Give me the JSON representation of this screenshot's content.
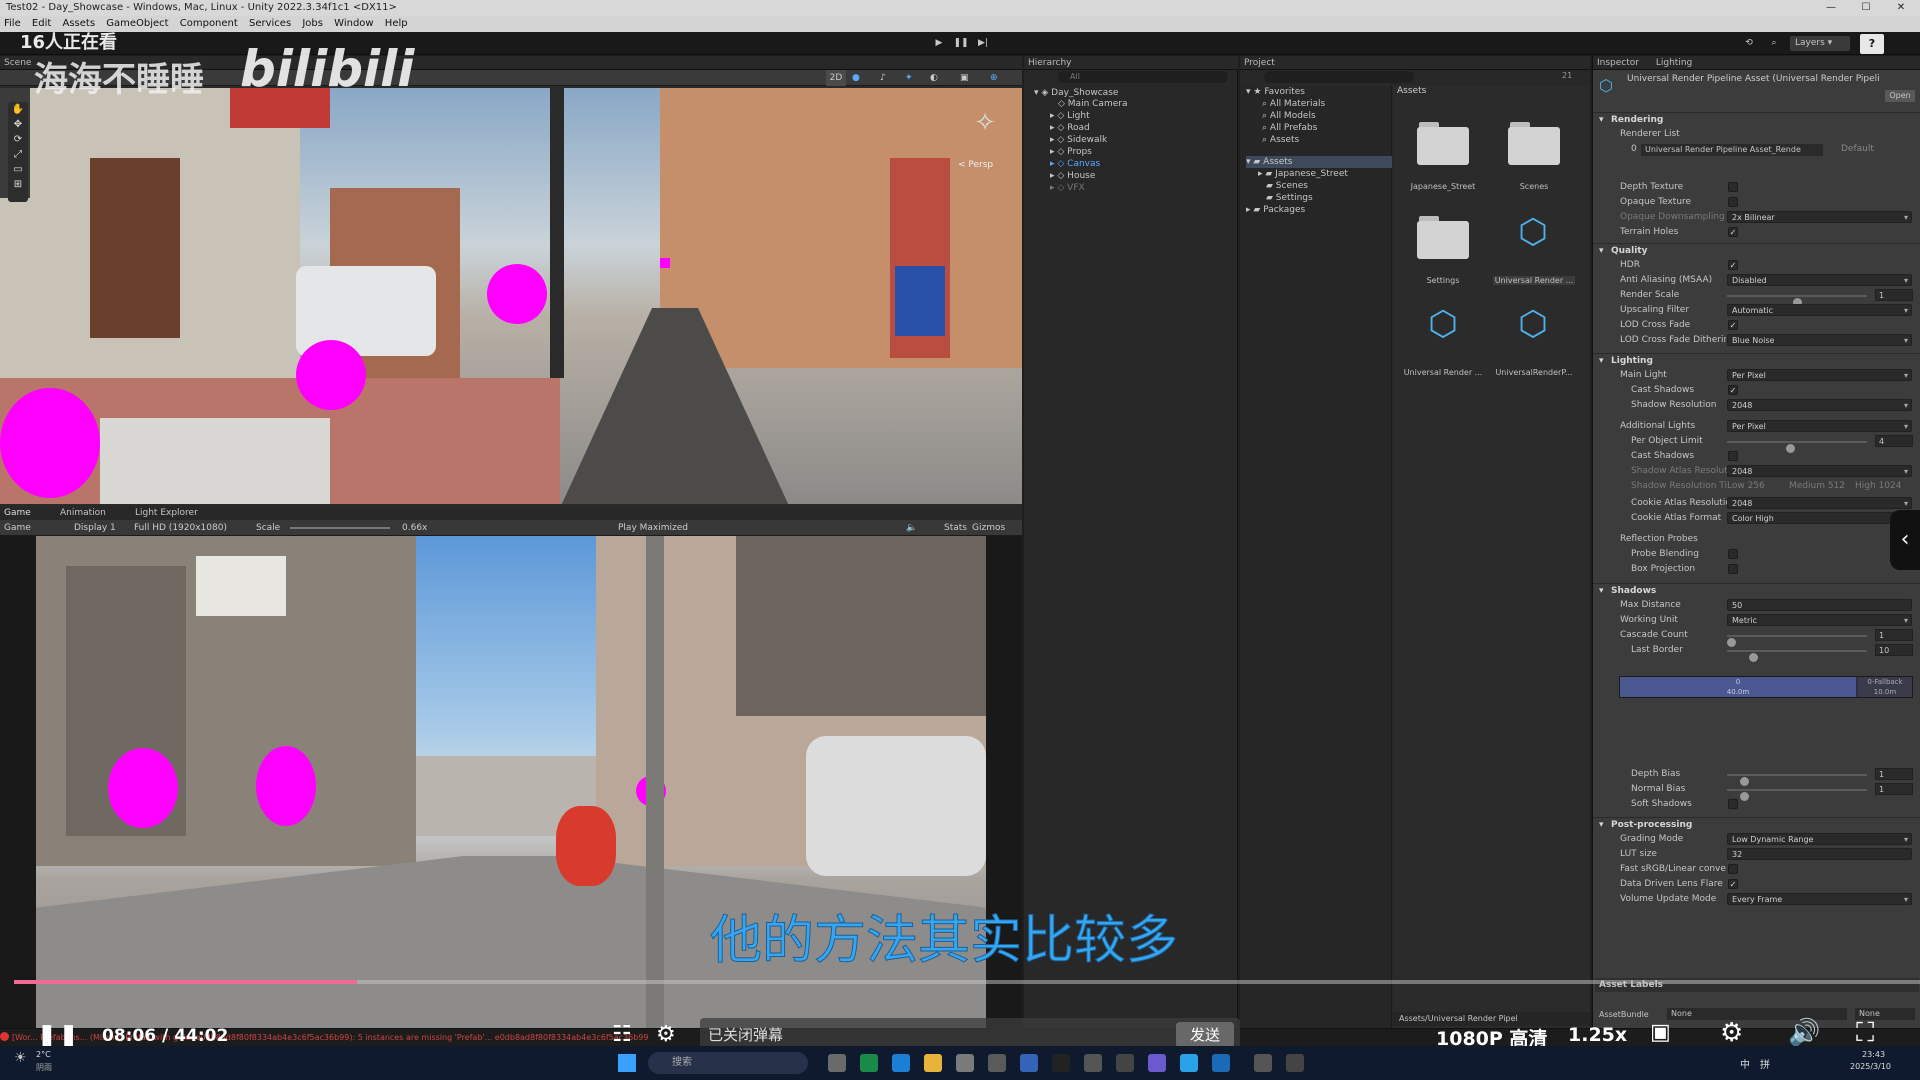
{
  "window": {
    "title": "Test02 - Day_Showcase - Windows, Mac, Linux - Unity 2022.3.34f1c1 <DX11>",
    "controls": [
      "—",
      "☐",
      "✕"
    ]
  },
  "menu": [
    "File",
    "Edit",
    "Assets",
    "GameObject",
    "Component",
    "Services",
    "Jobs",
    "Window",
    "Help"
  ],
  "overlay": {
    "viewers": "16人正在看",
    "watermark_user": "海海不睡睡",
    "watermark_brand": "bilibili",
    "subtitle": "他的方法其实比较多",
    "time_current": "08:06",
    "time_total": "44:02",
    "time_sep": "/",
    "danmaku_status": "已关闭弹幕",
    "send_label": "发送",
    "quality": "1080P 高清",
    "speed": "1.25x",
    "progress": 0.18
  },
  "toolbar": {
    "layers_label": "Layers",
    "help": "?"
  },
  "scene": {
    "tab": "Scene",
    "mode_2d": "2D",
    "persp_label": "< Persp"
  },
  "game": {
    "tabs": [
      "Game",
      "Animation",
      "Light Explorer"
    ],
    "display_label": "Game",
    "display": "Display 1",
    "resolution": "Full HD (1920x1080)",
    "scale_label": "Scale",
    "scale_value": "0.66x",
    "play_mode": "Play Maximized",
    "stats": "Stats",
    "gizmos": "Gizmos"
  },
  "hierarchy": {
    "tab": "Hierarchy",
    "search_placeholder": "All",
    "scene_name": "Day_Showcase",
    "items": [
      "Main Camera",
      "Light",
      "Road",
      "Sidewalk",
      "Props",
      "Canvas",
      "House",
      "VFX"
    ]
  },
  "project": {
    "tab": "Project",
    "favorites_label": "Favorites",
    "favorites": [
      "All Materials",
      "All Models",
      "All Prefabs",
      "Assets"
    ],
    "assets_label": "Assets",
    "asset_folders": [
      "Japanese_Street",
      "Scenes",
      "Settings"
    ],
    "packages_label": "Packages",
    "grid_header": "Assets",
    "grid_items": [
      "Japanese_Street",
      "Scenes",
      "Settings",
      "Universal Render ...",
      "Universal Render ...",
      "UniversalRenderP..."
    ],
    "footer_path": "Assets/Universal Render Pipel",
    "item_count": "21"
  },
  "inspector": {
    "tabs": [
      "Inspector",
      "Lighting"
    ],
    "asset_title": "Universal Render Pipeline Asset (Universal Render Pipeli",
    "open_button": "Open",
    "rendering": {
      "title": "Rendering",
      "renderer_list": "Renderer List",
      "renderer_index": "0",
      "renderer_name": "Universal Render Pipeline Asset_Rende",
      "renderer_default": "Default",
      "depth_texture": "Depth Texture",
      "opaque_texture": "Opaque Texture",
      "opaque_downsampling": "Opaque Downsampling",
      "opaque_downsampling_value": "2x Bilinear",
      "terrain_holes": "Terrain Holes"
    },
    "quality": {
      "title": "Quality",
      "hdr": "HDR",
      "aa": "Anti Aliasing (MSAA)",
      "aa_value": "Disabled",
      "render_scale": "Render Scale",
      "render_scale_value": "1",
      "render_scale_fraction": 0.5,
      "upscaling": "Upscaling Filter",
      "upscaling_value": "Automatic",
      "lod_cross": "LOD Cross Fade",
      "lod_dither": "LOD Cross Fade Dithering",
      "lod_dither_value": "Blue Noise"
    },
    "lighting": {
      "title": "Lighting",
      "main_light": "Main Light",
      "main_light_value": "Per Pixel",
      "cast_shadows": "Cast Shadows",
      "shadow_res": "Shadow Resolution",
      "shadow_res_value": "2048",
      "additional_lights": "Additional Lights",
      "additional_lights_value": "Per Pixel",
      "per_object_limit": "Per Object Limit",
      "per_object_limit_value": "4",
      "per_object_fraction": 0.45,
      "cast_shadows2": "Cast Shadows",
      "atlas_res": "Shadow Atlas Resolution",
      "atlas_res_value": "2048",
      "res_tiers": "Shadow Resolution Tiers",
      "tier_low": "Low  256",
      "tier_med": "Medium  512",
      "tier_high": "High  1024",
      "cookie_res": "Cookie Atlas Resolution",
      "cookie_res_value": "2048",
      "cookie_format": "Cookie Atlas Format",
      "cookie_format_value": "Color High",
      "reflection_probes": "Reflection Probes",
      "probe_blending": "Probe Blending",
      "box_projection": "Box Projection"
    },
    "shadows": {
      "title": "Shadows",
      "max_distance": "Max Distance",
      "max_distance_value": "50",
      "working_unit": "Working Unit",
      "working_unit_value": "Metric",
      "cascade_count": "Cascade Count",
      "cascade_count_value": "1",
      "cascade_fraction": 0.0,
      "last_border": "Last Border",
      "last_border_value": "10",
      "last_border_fraction": 0.17,
      "cascade_bar_left": "0\n40.0m",
      "cascade_bar_right": "0-Fallback\n10.0m",
      "depth_bias": "Depth Bias",
      "depth_bias_value": "1",
      "depth_bias_fraction": 0.1,
      "normal_bias": "Normal Bias",
      "normal_bias_value": "1",
      "normal_bias_fraction": 0.1,
      "soft_shadows": "Soft Shadows"
    },
    "post": {
      "title": "Post-processing",
      "grading_mode": "Grading Mode",
      "grading_mode_value": "Low Dynamic Range",
      "lut_size": "LUT size",
      "lut_size_value": "32",
      "fast_srgb": "Fast sRGB/Linear conversion",
      "lens_flare": "Data Driven Lens Flare",
      "volume_update": "Volume Update Mode",
      "volume_update_value": "Every Frame"
    },
    "asset_labels": "Asset Labels",
    "asset_bundle": "AssetBundle",
    "asset_bundle_value": "None",
    "asset_bundle_variant": "None"
  },
  "console": {
    "message": "[Wor... Prefab ins... (Missing Prefab with guid: e0db8ad8f80f8334ab4e3c6f5ac36b99): 5 instances are missing 'Prefab'... e0db8ad8f80f8334ab4e3c6f5ac36b99"
  },
  "taskbar": {
    "weather_temp": "2°C",
    "weather_desc": "阴雨",
    "search_placeholder": "搜索",
    "ime": [
      "中",
      "拼"
    ],
    "time": "23:43",
    "date": "2025/3/10"
  },
  "colors": {
    "accent_blue": "#4fb0ea",
    "progress_pink": "#f16a94",
    "subtitle_blue": "#34a6f2",
    "magenta_missing": "#ff00ff"
  }
}
